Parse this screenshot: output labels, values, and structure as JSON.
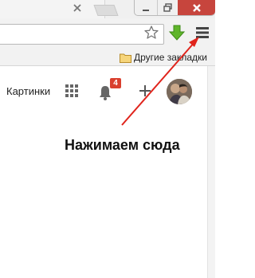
{
  "bookmarks": {
    "other_bookmarks_label": "Другие закладки"
  },
  "page": {
    "images_link": "Картинки",
    "notification_count": "4"
  },
  "annotation": {
    "text": "Нажимаем сюда"
  },
  "colors": {
    "accent_red": "#d93f2e",
    "arrow_red": "#e0241c",
    "download_green": "#5fb52a",
    "close_red": "#c7453d"
  }
}
